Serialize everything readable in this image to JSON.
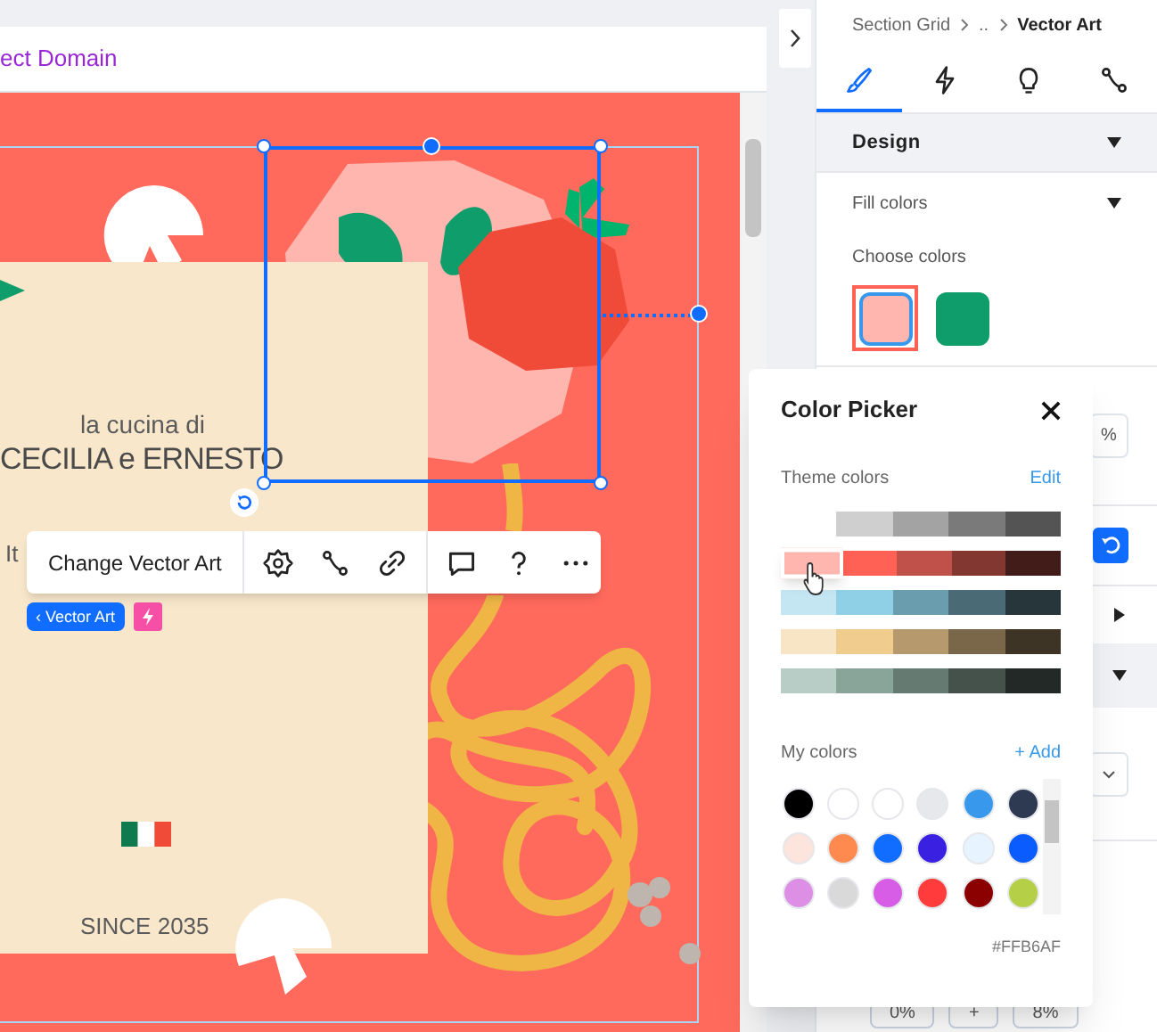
{
  "top_bar": {
    "link": "ect Domain"
  },
  "canvas": {
    "partial_text": "It",
    "subtitle": "la cucina di",
    "title": "CECILIA e ERNESTO",
    "since": "SINCE 2035",
    "toolbar": {
      "primary": "Change Vector Art"
    },
    "tag": "‹ Vector Art"
  },
  "panel": {
    "breadcrumb": [
      "Section Grid",
      "..",
      "Vector Art"
    ],
    "tabs": [
      {
        "kind": "design",
        "selected": true
      },
      {
        "kind": "animation",
        "selected": false
      },
      {
        "kind": "idea",
        "selected": false
      },
      {
        "kind": "connect",
        "selected": false
      }
    ],
    "section": {
      "title": "Design",
      "expanded": true
    },
    "fill_colors": "Fill colors",
    "choose_colors": "Choose colors",
    "swatches": [
      {
        "color": "#ffb6af",
        "selected": true
      },
      {
        "color": "#0f9d6b",
        "selected": false
      }
    ],
    "unit": "%",
    "bottom_values": [
      "0%",
      "+",
      "8%"
    ]
  },
  "color_picker": {
    "title": "Color Picker",
    "theme_label": "Theme colors",
    "edit": "Edit",
    "theme_rows": [
      [
        {
          "color": "#ffffff",
          "selected": false
        },
        {
          "color": "#cfcfcf",
          "selected": false
        },
        {
          "color": "#a3a3a3",
          "selected": false
        },
        {
          "color": "#7a7a7a",
          "selected": false
        },
        {
          "color": "#545454",
          "selected": false
        }
      ],
      [
        {
          "color": "#ffb6af",
          "selected": true
        },
        {
          "color": "#ff6155",
          "selected": false
        },
        {
          "color": "#c0504a",
          "selected": false
        },
        {
          "color": "#823731",
          "selected": false
        },
        {
          "color": "#421c19",
          "selected": false
        }
      ],
      [
        {
          "color": "#c4e6f2",
          "selected": false
        },
        {
          "color": "#8fd0e6",
          "selected": false
        },
        {
          "color": "#6a9eae",
          "selected": false
        },
        {
          "color": "#4a6a75",
          "selected": false
        },
        {
          "color": "#26363b",
          "selected": false
        }
      ],
      [
        {
          "color": "#f8e5c6",
          "selected": false
        },
        {
          "color": "#f1cc8f",
          "selected": false
        },
        {
          "color": "#b69a6d",
          "selected": false
        },
        {
          "color": "#7a6749",
          "selected": false
        },
        {
          "color": "#3d3425",
          "selected": false
        }
      ],
      [
        {
          "color": "#b7cdc5",
          "selected": false
        },
        {
          "color": "#89a498",
          "selected": false
        },
        {
          "color": "#657b72",
          "selected": false
        },
        {
          "color": "#45524c",
          "selected": false
        },
        {
          "color": "#232926",
          "selected": false
        }
      ]
    ],
    "my_label": "My colors",
    "add": "+ Add",
    "my_colors": [
      {
        "color": "#000000"
      },
      {
        "color": "#ffffff"
      },
      {
        "color": "#ffffff"
      },
      {
        "color": "#e6e8eb"
      },
      {
        "color": "#3899ec"
      },
      {
        "color": "#2e3a52"
      },
      {
        "color": "#fde4dc"
      },
      {
        "color": "#ff8a50"
      },
      {
        "color": "#116dff"
      },
      {
        "color": "#3a20e0"
      },
      {
        "color": "#e7f3ff"
      },
      {
        "color": "#0a5cff"
      },
      {
        "color": "#dd8fe6"
      },
      {
        "color": "#d9d9d9"
      },
      {
        "color": "#d75ce6"
      },
      {
        "color": "#ff3b3b"
      },
      {
        "color": "#8b0000"
      },
      {
        "color": "#b5cf47"
      }
    ],
    "hex": "#FFB6AF"
  }
}
